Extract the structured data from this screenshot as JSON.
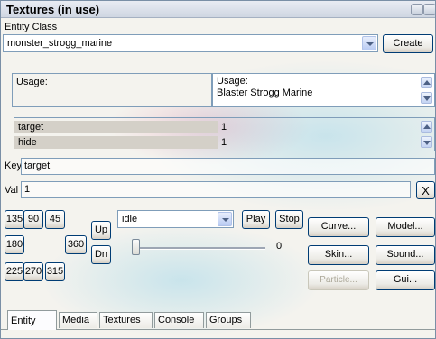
{
  "window": {
    "title": "Textures (in use)"
  },
  "entity_class": {
    "label": "Entity Class",
    "value": "monster_strogg_marine",
    "create_label": "Create"
  },
  "usage": {
    "label": "Usage:",
    "detail_label": "Usage:",
    "detail_value": "Blaster Strogg Marine"
  },
  "properties": [
    {
      "key": "target",
      "value": "1"
    },
    {
      "key": "hide",
      "value": "1"
    }
  ],
  "key_field": {
    "label": "Key",
    "value": "target"
  },
  "val_field": {
    "label": "Val",
    "value": "1",
    "clear_label": "X"
  },
  "angles": [
    "135",
    "90",
    "45",
    "180",
    "360",
    "225",
    "270",
    "315"
  ],
  "controls": {
    "up_label": "Up",
    "dn_label": "Dn",
    "anim_value": "idle",
    "play_label": "Play",
    "stop_label": "Stop",
    "slider_value": "0"
  },
  "right_buttons": {
    "curve": "Curve...",
    "model": "Model...",
    "skin": "Skin...",
    "sound": "Sound...",
    "particle": "Particle...",
    "gui": "Gui..."
  },
  "tabs": [
    "Entity",
    "Media",
    "Textures",
    "Console",
    "Groups"
  ]
}
